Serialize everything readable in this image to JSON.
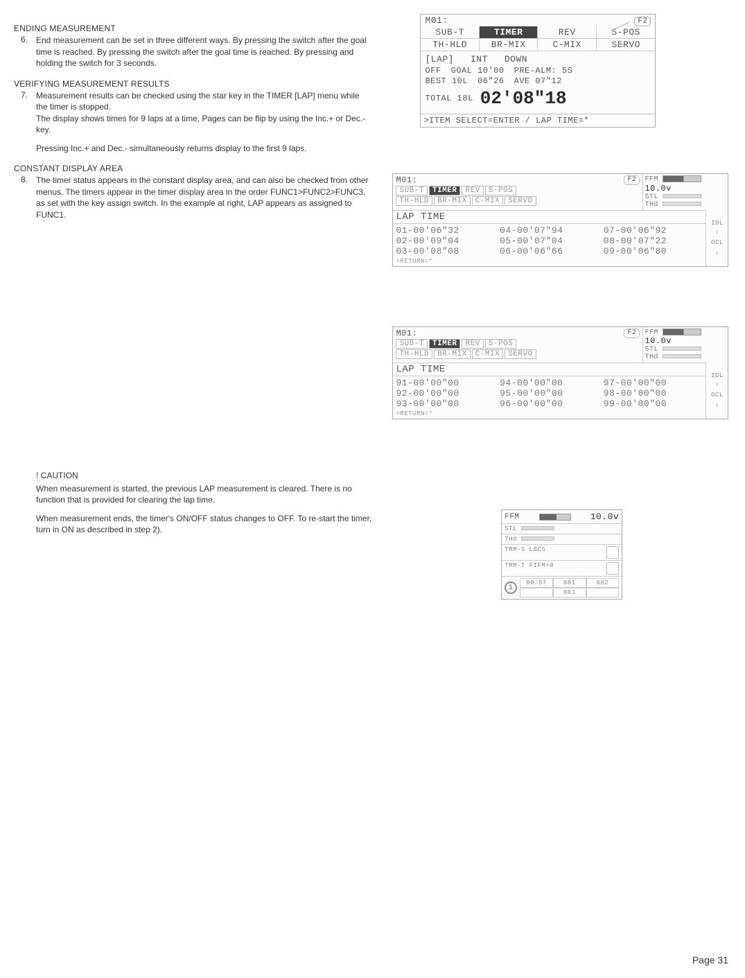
{
  "left": {
    "sec1": {
      "head": "ENDING MEASUREMENT",
      "num": "6.",
      "body": "End measurement can be set in three different ways. By pressing the switch after the goal time is reached. By pressing the switch after the goal time is reached. By pressing and holding the switch for 3 seconds."
    },
    "sec2": {
      "head": "VERIFYING MEASUREMENT RESULTS",
      "num": "7.",
      "body1": "Measurement results can be checked using the star key in the TIMER [LAP] menu while the timer is stopped.",
      "body2": "The display shows times for 9 laps at a time, Pages can be flip by using the Inc.+ or Dec.- key.",
      "body3": "Pressing Inc.+ and Dec.- simultaneously returns display to the first 9 laps."
    },
    "sec3": {
      "head": "CONSTANT DISPLAY AREA",
      "num": "8.",
      "body": "The timer status appears in the constant display area, and can also be checked from other menus. The timers appear in the timer display area in the order FUNC1>FUNC2>FUNC3, as set with the key assign switch. In the example at right, LAP appears as assigned to FUNC1."
    },
    "caution": {
      "head": "! CAUTION",
      "b1": "When measurement is started, the previous LAP measurement is cleared. There is no function that is provided for clearing the lap time.",
      "b2": "When measurement ends, the timer's ON/OFF status changes to OFF. To re-start the timer, turn in ON as described in step 2)."
    }
  },
  "lcd1": {
    "title": "M01:",
    "corner": "F2",
    "tabs": {
      "a": "SUB-T",
      "b": "TIMER",
      "c": "REV",
      "d": "S-POS"
    },
    "row2": {
      "a": "TH-HLD",
      "b": "BR-MIX",
      "c": "C-MIX",
      "d": "SERVO"
    },
    "lap": {
      "h1": "[LAP]",
      "h2": "INT",
      "h3": "DOWN",
      "l1a": "OFF",
      "l1b": "GOAL 10'00",
      "l1c": "PRE-ALM:  5S",
      "l2a": "BEST 10L",
      "l2b": "06\"26",
      "l2c": "AVE 07\"12",
      "l3a": "TOTAL 18L",
      "big": "02'08\"18"
    },
    "foot": ">ITEM SELECT=ENTER / LAP TIME=*"
  },
  "lcd2": {
    "title": "M01:",
    "corner": "F2",
    "sideval": "10.0v",
    "tabs": {
      "a": "SUB-T",
      "b": "TIMER",
      "c": "REV",
      "d": "S-POS"
    },
    "row2": {
      "a": "TH-HLD",
      "b": "BR-MIX",
      "c": "C-MIX",
      "d": "SERVO"
    },
    "sideL1": "FFM",
    "sideL2": "STL",
    "sideL3": "THd",
    "laphead": "LAP TIME",
    "cells": [
      "01-00'06\"32",
      "04-00'07\"94",
      "07-00'06\"92",
      "02-00'09\"04",
      "05-00'07\"04",
      "08-00'07\"22",
      "03-00'08\"08",
      "06-00'06\"66",
      "09-00'06\"80"
    ],
    "foot": ">RETURN=*",
    "badges": [
      "IDL",
      "↑",
      "OCL",
      "↓"
    ]
  },
  "lcd3": {
    "title": "M01:",
    "corner": "F2",
    "sideval": "10.0v",
    "tabs": {
      "a": "SUB-T",
      "b": "TIMER",
      "c": "REV",
      "d": "S-POS"
    },
    "row2": {
      "a": "TH-HLD",
      "b": "BR-MIX",
      "c": "C-MIX",
      "d": "SERVO"
    },
    "sideL1": "FFM",
    "sideL2": "STL",
    "sideL3": "THd",
    "laphead": "LAP TIME",
    "cells": [
      "91-00'00\"00",
      "94-00'00\"00",
      "97-00'00\"00",
      "92-00'00\"00",
      "95-00'00\"00",
      "98-00'00\"00",
      "93-00'00\"00",
      "96-00'00\"00",
      "99-00'00\"00"
    ],
    "foot": ">RETURN=*",
    "badges": [
      "IDL",
      "↑",
      "OCL",
      "↓"
    ]
  },
  "lcd4": {
    "topL": "FFM",
    "topVal": "10.0v",
    "r1": "STL",
    "r1b": "THd",
    "mA": "TRM-S",
    "mB": "LBCS",
    "mA2": "TRM-T",
    "mB2": "FIFM+0",
    "grid": [
      "00:57",
      "081",
      "082",
      "083"
    ],
    "icon": "i"
  },
  "pagenum": "Page 31"
}
